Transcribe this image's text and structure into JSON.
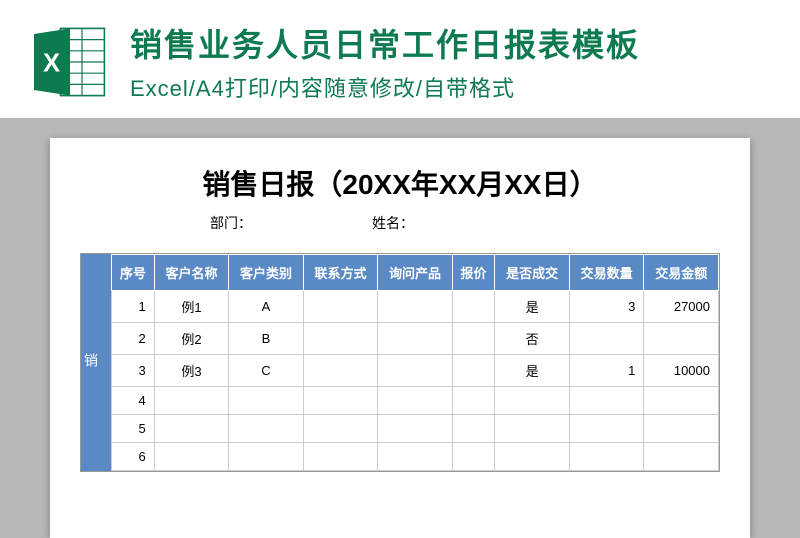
{
  "header": {
    "title": "销售业务人员日常工作日报表模板",
    "subtitle": "Excel/A4打印/内容随意修改/自带格式"
  },
  "document": {
    "title": "销售日报（20XX年XX月XX日）",
    "dept_label": "部门：",
    "name_label": "姓名：",
    "side_label": "销"
  },
  "table": {
    "headers": [
      "序号",
      "客户名称",
      "客户类别",
      "联系方式",
      "询问产品",
      "报价",
      "是否成交",
      "交易数量",
      "交易金额"
    ],
    "rows": [
      {
        "seq": "1",
        "customer": "例1",
        "category": "A",
        "contact": "",
        "product": "",
        "quote": "",
        "deal": "是",
        "qty": "3",
        "amount": "27000"
      },
      {
        "seq": "2",
        "customer": "例2",
        "category": "B",
        "contact": "",
        "product": "",
        "quote": "",
        "deal": "否",
        "qty": "",
        "amount": ""
      },
      {
        "seq": "3",
        "customer": "例3",
        "category": "C",
        "contact": "",
        "product": "",
        "quote": "",
        "deal": "是",
        "qty": "1",
        "amount": "10000"
      },
      {
        "seq": "4",
        "customer": "",
        "category": "",
        "contact": "",
        "product": "",
        "quote": "",
        "deal": "",
        "qty": "",
        "amount": ""
      },
      {
        "seq": "5",
        "customer": "",
        "category": "",
        "contact": "",
        "product": "",
        "quote": "",
        "deal": "",
        "qty": "",
        "amount": ""
      },
      {
        "seq": "6",
        "customer": "",
        "category": "",
        "contact": "",
        "product": "",
        "quote": "",
        "deal": "",
        "qty": "",
        "amount": ""
      }
    ]
  },
  "colors": {
    "brand_green": "#0d7a4f",
    "table_blue": "#5a8ac6"
  }
}
